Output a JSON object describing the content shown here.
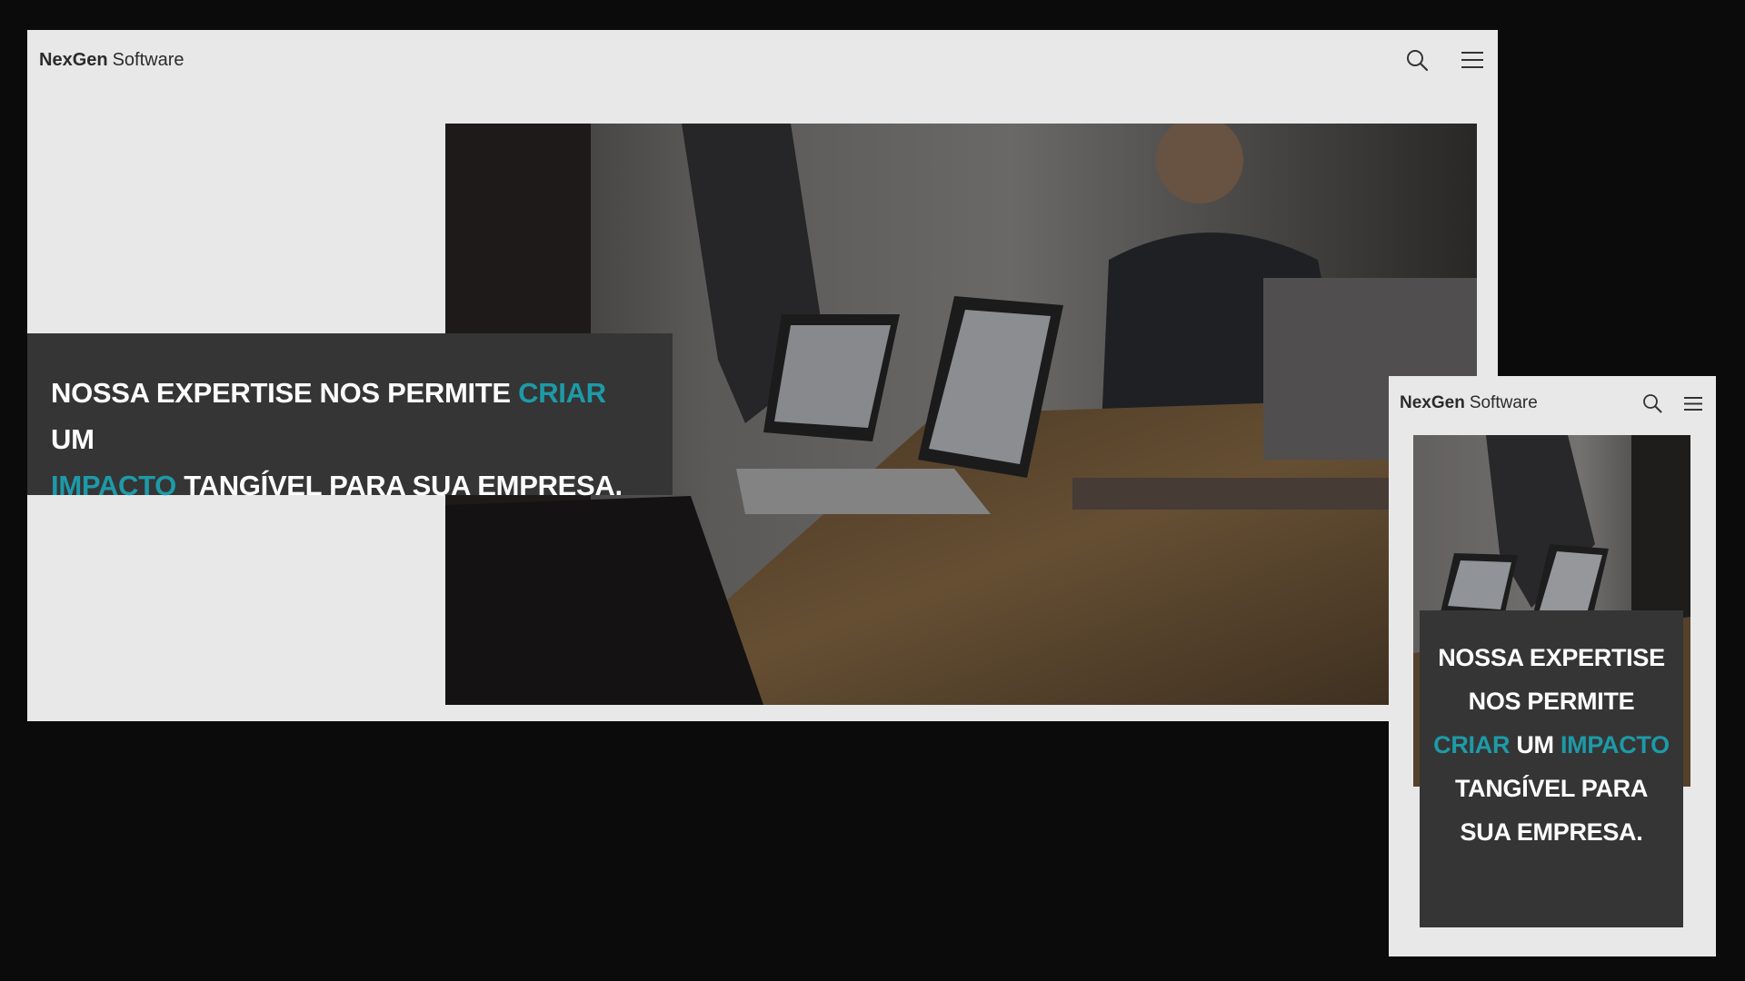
{
  "desktop": {
    "brand": {
      "strong": "NexGen",
      "light": "Software"
    },
    "nav": {
      "search_icon": "search-icon",
      "menu_icon": "hamburger-menu-icon"
    },
    "hero": {
      "image_subject": "team meeting with laptops showing charts",
      "headline": {
        "part1": "NOSSA EXPERTISE NOS PERMITE ",
        "accent1": "CRIAR",
        "part2": " UM ",
        "accent2": "IMPACTO",
        "part3": " TANGÍVEL PARA SUA EMPRESA."
      }
    }
  },
  "mobile": {
    "brand": {
      "strong": "NexGen",
      "light": "Software"
    },
    "nav": {
      "search_icon": "search-icon",
      "menu_icon": "hamburger-menu-icon"
    },
    "hero": {
      "image_subject": "team meeting with laptops showing charts",
      "headline": {
        "part1": "NOSSA EXPERTISE NOS PERMITE ",
        "accent1": "CRIAR",
        "part2": " UM ",
        "accent2": "IMPACTO",
        "part3": " TANGÍVEL PARA SUA EMPRESA."
      }
    }
  },
  "colors": {
    "background": "#0b0b0b",
    "page": "#e8e8e8",
    "headline_box": "#353535",
    "accent": "#1d9aa8",
    "brand_text": "#2b2b2b"
  }
}
